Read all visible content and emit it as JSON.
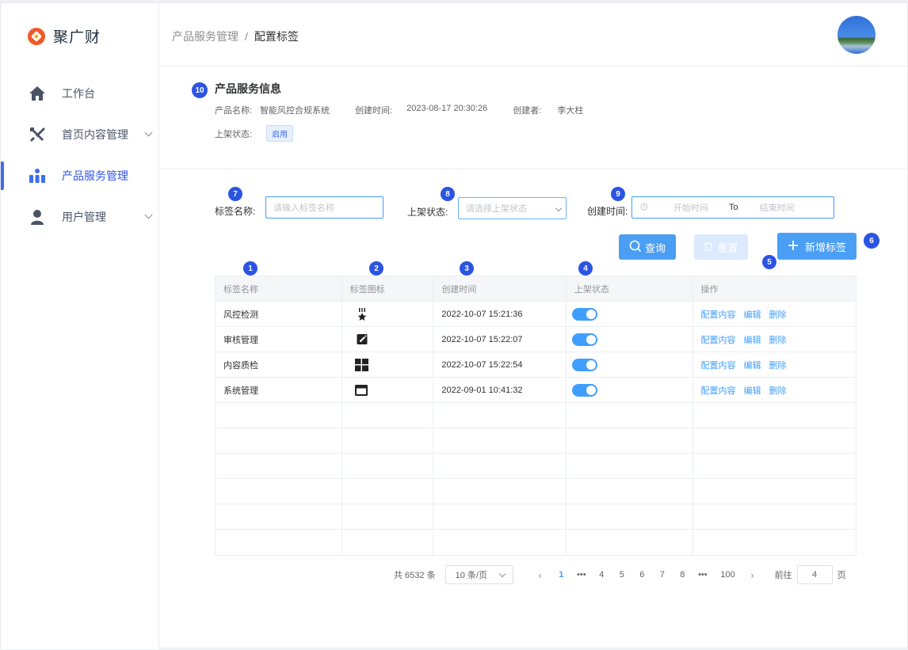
{
  "app": {
    "name": "聚广财"
  },
  "breadcrumb": {
    "parent": "产品服务管理",
    "separator": "/",
    "current": "配置标签"
  },
  "sidebar": {
    "items": [
      {
        "label": "工作台",
        "icon": "home-icon",
        "has_children": false,
        "active": false
      },
      {
        "label": "首页内容管理",
        "icon": "tools-icon",
        "has_children": true,
        "active": false
      },
      {
        "label": "产品服务管理",
        "icon": "org-chart-icon",
        "has_children": false,
        "active": true
      },
      {
        "label": "用户管理",
        "icon": "user-icon",
        "has_children": true,
        "active": false
      }
    ]
  },
  "info": {
    "title": "产品服务信息",
    "product_name_label": "产品名称:",
    "product_name": "智能风控合规系统",
    "created_label": "创建时间:",
    "created": "2023-08-17  20:30:26",
    "creator_label": "创建者:",
    "creator": "李大柱",
    "status_label": "上架状态:",
    "status": "启用"
  },
  "filters": {
    "name_label": "标签名称:",
    "name_placeholder": "请输入标签名称",
    "status_label": "上架状态:",
    "status_placeholder": "请选择上架状态",
    "time_label": "创建时间:",
    "start_placeholder": "开始时间",
    "to": "To",
    "end_placeholder": "结束时间"
  },
  "buttons": {
    "query": "查询",
    "reset": "重置",
    "add": "新增标签"
  },
  "badges": [
    "1",
    "2",
    "3",
    "4",
    "5",
    "6",
    "7",
    "8",
    "9",
    "10"
  ],
  "table": {
    "columns": [
      "标签名称",
      "标签图标",
      "创建时间",
      "上架状态",
      "操作"
    ],
    "rows": [
      {
        "name": "风控检测",
        "icon": "medal-icon",
        "created": "2022-10-07 15:21:36",
        "enabled": true
      },
      {
        "name": "审核管理",
        "icon": "edit-square-icon",
        "created": "2022-10-07 15:22:07",
        "enabled": true
      },
      {
        "name": "内容质检",
        "icon": "grid-icon",
        "created": "2022-10-07 15:22:54",
        "enabled": true
      },
      {
        "name": "系统管理",
        "icon": "window-icon",
        "created": "2022-09-01 10:41:32",
        "enabled": true
      }
    ],
    "actions": [
      "配置内容",
      "编辑",
      "删除"
    ]
  },
  "pagination": {
    "total": "共 6532 条",
    "page_size": "10 条/页",
    "pages": [
      "1",
      "•••",
      "4",
      "5",
      "6",
      "7",
      "8",
      "•••",
      "100"
    ],
    "current": "1",
    "goto_label": "前往",
    "goto_value": "4",
    "goto_suffix": "页"
  },
  "colors": {
    "accent": "#409eff",
    "badge": "#2b54e3",
    "brand": "#f05a28"
  }
}
